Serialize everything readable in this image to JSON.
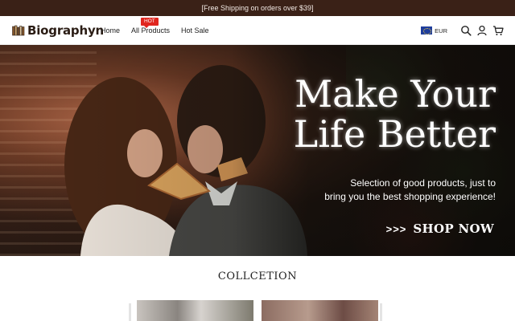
{
  "announcement": {
    "text": "[Free Shipping on orders over $39]"
  },
  "header": {
    "brand": "Biographyn",
    "nav": [
      {
        "label": "Home"
      },
      {
        "label": "All Products",
        "badge": "HOT"
      },
      {
        "label": "Hot Sale"
      }
    ],
    "currency": "EUR",
    "icons": [
      "eu-flag-icon",
      "search-icon",
      "account-icon",
      "cart-icon"
    ]
  },
  "hero": {
    "title_line1": "Make Your",
    "title_line2": "Life Better",
    "subtitle_line1": "Selection of good products, just to",
    "subtitle_line2": "bring you the best shopping experience!",
    "cta_arrows": ">>>",
    "cta_label": "SHOP NOW"
  },
  "collection": {
    "title": "COLLCETION"
  },
  "colors": {
    "announcement_bg": "#3a2117",
    "hot_badge": "#e0261f",
    "brand_text": "#2a1c14"
  }
}
